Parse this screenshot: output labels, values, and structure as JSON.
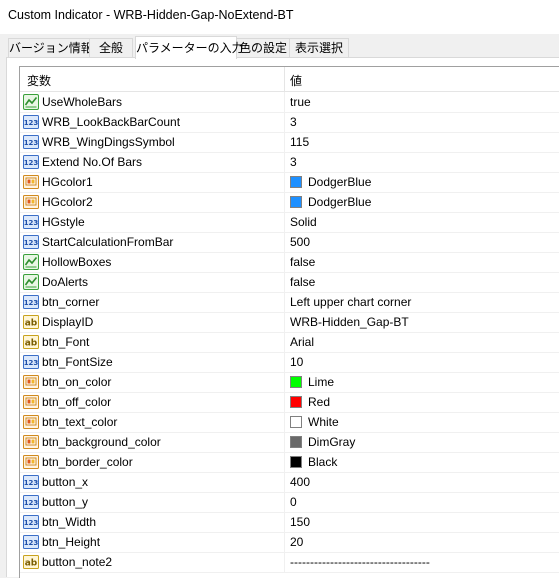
{
  "window": {
    "title": "Custom Indicator - WRB-Hidden-Gap-NoExtend-BT"
  },
  "tabs": [
    {
      "label": "バージョン情報"
    },
    {
      "label": "全般"
    },
    {
      "label": "パラメーターの入力"
    },
    {
      "label": "色の設定"
    },
    {
      "label": "表示選択"
    }
  ],
  "table": {
    "headers": {
      "variable": "変数",
      "value": "値"
    },
    "rows": [
      {
        "icon": "bool-icon",
        "name": "UseWholeBars",
        "value": "true"
      },
      {
        "icon": "int-icon",
        "name": "WRB_LookBackBarCount",
        "value": "3"
      },
      {
        "icon": "int-icon",
        "name": "WRB_WingDingsSymbol",
        "value": "115"
      },
      {
        "icon": "int-icon",
        "name": "Extend No.Of Bars",
        "value": "3"
      },
      {
        "icon": "color-icon",
        "name": "HGcolor1",
        "value": "DodgerBlue",
        "color": "#1e90ff"
      },
      {
        "icon": "color-icon",
        "name": "HGcolor2",
        "value": "DodgerBlue",
        "color": "#1e90ff"
      },
      {
        "icon": "int-icon",
        "name": "HGstyle",
        "value": "Solid"
      },
      {
        "icon": "int-icon",
        "name": "StartCalculationFromBar",
        "value": "500"
      },
      {
        "icon": "bool-icon",
        "name": "HollowBoxes",
        "value": "false"
      },
      {
        "icon": "bool-icon",
        "name": "DoAlerts",
        "value": "false"
      },
      {
        "icon": "int-icon",
        "name": "btn_corner",
        "value": "Left upper chart corner"
      },
      {
        "icon": "string-icon",
        "name": "DisplayID",
        "value": "WRB-Hidden_Gap-BT"
      },
      {
        "icon": "string-icon",
        "name": "btn_Font",
        "value": "Arial"
      },
      {
        "icon": "int-icon",
        "name": "btn_FontSize",
        "value": "10"
      },
      {
        "icon": "color-icon",
        "name": "btn_on_color",
        "value": "Lime",
        "color": "#00ff00"
      },
      {
        "icon": "color-icon",
        "name": "btn_off_color",
        "value": "Red",
        "color": "#ff0000"
      },
      {
        "icon": "color-icon",
        "name": "btn_text_color",
        "value": "White",
        "color": "#ffffff"
      },
      {
        "icon": "color-icon",
        "name": "btn_background_color",
        "value": "DimGray",
        "color": "#696969"
      },
      {
        "icon": "color-icon",
        "name": "btn_border_color",
        "value": "Black",
        "color": "#000000"
      },
      {
        "icon": "int-icon",
        "name": "button_x",
        "value": "400"
      },
      {
        "icon": "int-icon",
        "name": "button_y",
        "value": "0"
      },
      {
        "icon": "int-icon",
        "name": "btn_Width",
        "value": "150"
      },
      {
        "icon": "int-icon",
        "name": "btn_Height",
        "value": "20"
      },
      {
        "icon": "string-icon",
        "name": "button_note2",
        "value": "-----------------------------------"
      }
    ]
  }
}
